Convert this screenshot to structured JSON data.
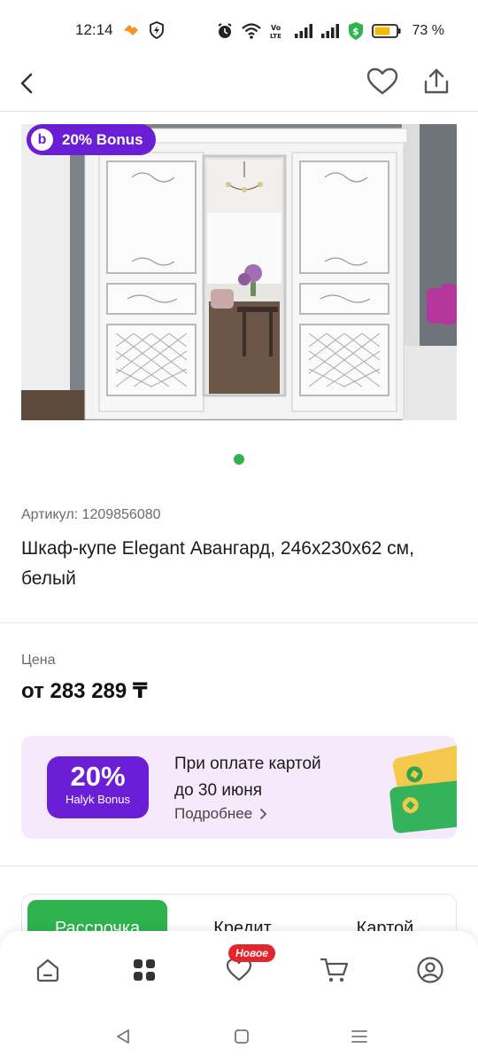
{
  "status_bar": {
    "time": "12:14",
    "battery_percent": "73 %",
    "battery_level": 0.73
  },
  "gallery": {
    "bonus_badge": "20% Bonus",
    "bonus_logo": "b",
    "active_slide": 1,
    "slide_count": 1
  },
  "product": {
    "article": "Артикул: 1209856080",
    "title": "Шкаф-купе Elegant Авангард, 246х230х62 см, белый"
  },
  "price": {
    "label": "Цена",
    "value": "от 283 289 ₸"
  },
  "promo": {
    "percent": "20%",
    "sub": "Halyk Bonus",
    "line1": "При оплате картой",
    "line2": "до 30 июня",
    "more": "Подробнее",
    "colors": {
      "background": "#f6e9fb",
      "accent": "#6a1fd6"
    }
  },
  "payment_tabs": [
    {
      "label": "Рассрочка",
      "active": true
    },
    {
      "label": "Кредит",
      "active": false
    },
    {
      "label": "Картой",
      "active": false
    }
  ],
  "bottom_nav": {
    "new_badge": "Новое",
    "items": [
      "home-icon",
      "catalog-icon",
      "favorites-icon",
      "cart-icon",
      "profile-icon"
    ]
  },
  "colors": {
    "green": "#2fb34f",
    "purple": "#6a1fd6",
    "red": "#e3262d"
  }
}
